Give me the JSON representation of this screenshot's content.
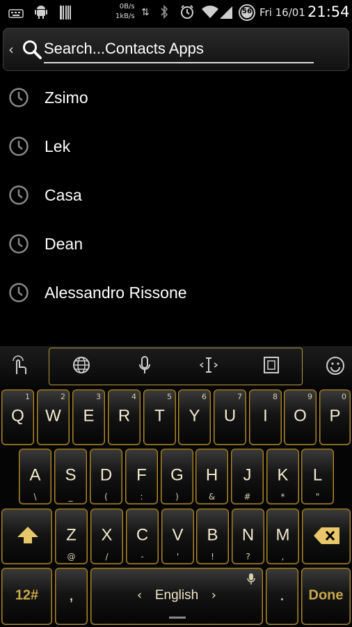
{
  "status_bar": {
    "net_up": "0B/s",
    "net_down": "1kB/s",
    "date": "Fri 16/01",
    "time": "21:54",
    "badge": "56",
    "icons": [
      "keyboard-icon",
      "android-icon",
      "barcode-icon",
      "bluetooth-icon",
      "alarm-icon",
      "wifi-icon",
      "signal-icon"
    ]
  },
  "search": {
    "placeholder": "Search...Contacts Apps"
  },
  "recent": [
    {
      "label": "Zsimo"
    },
    {
      "label": "Lek"
    },
    {
      "label": "Casa"
    },
    {
      "label": "Dean"
    },
    {
      "label": "Alessandro Rissone"
    }
  ],
  "keyboard": {
    "row1": [
      {
        "key": "Q",
        "num": "1"
      },
      {
        "key": "W",
        "num": "2"
      },
      {
        "key": "E",
        "num": "3"
      },
      {
        "key": "R",
        "num": "4"
      },
      {
        "key": "T",
        "num": "5"
      },
      {
        "key": "Y",
        "num": "6"
      },
      {
        "key": "U",
        "num": "7"
      },
      {
        "key": "I",
        "num": "8"
      },
      {
        "key": "O",
        "num": "9"
      },
      {
        "key": "P",
        "num": "0"
      }
    ],
    "row2": [
      {
        "key": "A",
        "alt": "\\"
      },
      {
        "key": "S",
        "alt": "_"
      },
      {
        "key": "D",
        "alt": "("
      },
      {
        "key": "F",
        "alt": ":"
      },
      {
        "key": "G",
        "alt": ")"
      },
      {
        "key": "H",
        "alt": "&"
      },
      {
        "key": "J",
        "alt": "#"
      },
      {
        "key": "K",
        "alt": "*"
      },
      {
        "key": "L",
        "alt": "\""
      }
    ],
    "row3": [
      {
        "key": "Z",
        "alt": "@"
      },
      {
        "key": "X",
        "alt": "/"
      },
      {
        "key": "C",
        "alt": "-"
      },
      {
        "key": "V",
        "alt": "'"
      },
      {
        "key": "B",
        "alt": "!"
      },
      {
        "key": "N",
        "alt": "?"
      },
      {
        "key": "M",
        "alt": ","
      }
    ],
    "symbols_label": "12#",
    "comma_label": ",",
    "space_label": "English",
    "period_label": ".",
    "done_label": "Done"
  },
  "colors": {
    "accent_gold": "#b08a2a",
    "background": "#000000"
  }
}
